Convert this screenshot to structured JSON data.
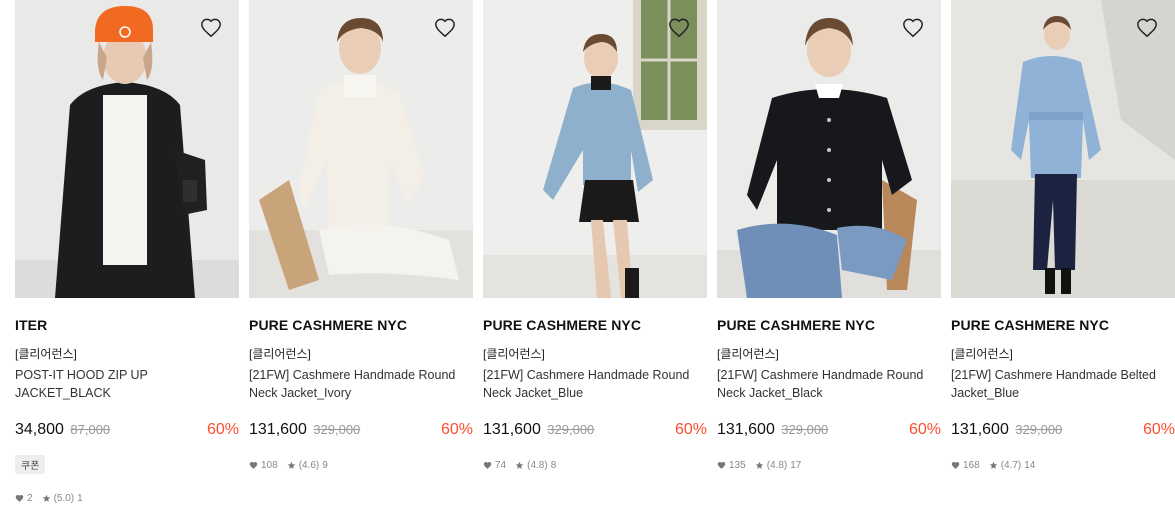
{
  "products": [
    {
      "brand": "ITER",
      "tag": "[클리어런스]",
      "name": "POST-IT HOOD ZIP UP JACKET_BLACK",
      "price": "34,800",
      "original_price": "87,000",
      "discount": "60%",
      "coupon": "쿠폰",
      "likes": "2",
      "rating": "(5.0)",
      "reviews": "1"
    },
    {
      "brand": "PURE CASHMERE NYC",
      "tag": "[클리어런스]",
      "name": "[21FW] Cashmere Handmade Round Neck Jacket_Ivory",
      "price": "131,600",
      "original_price": "329,000",
      "discount": "60%",
      "likes": "108",
      "rating": "(4.6)",
      "reviews": "9"
    },
    {
      "brand": "PURE CASHMERE NYC",
      "tag": "[클리어런스]",
      "name": "[21FW] Cashmere Handmade Round Neck Jacket_Blue",
      "price": "131,600",
      "original_price": "329,000",
      "discount": "60%",
      "likes": "74",
      "rating": "(4.8)",
      "reviews": "8"
    },
    {
      "brand": "PURE CASHMERE NYC",
      "tag": "[클리어런스]",
      "name": "[21FW] Cashmere Handmade Round Neck Jacket_Black",
      "price": "131,600",
      "original_price": "329,000",
      "discount": "60%",
      "likes": "135",
      "rating": "(4.8)",
      "reviews": "17"
    },
    {
      "brand": "PURE CASHMERE NYC",
      "tag": "[클리어런스]",
      "name": "[21FW] Cashmere Handmade Belted Jacket_Blue",
      "price": "131,600",
      "original_price": "329,000",
      "discount": "60%",
      "likes": "168",
      "rating": "(4.7)",
      "reviews": "14"
    }
  ],
  "icons": {
    "wishlist": "heart-outline-icon",
    "likes": "heart-icon",
    "rating": "star-icon"
  },
  "colors": {
    "discount": "#ff4d2e",
    "original_price": "#999999"
  }
}
